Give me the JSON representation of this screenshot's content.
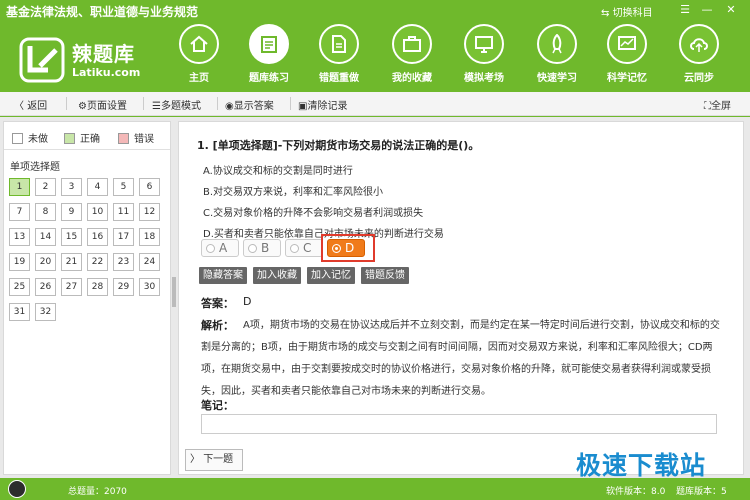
{
  "window": {
    "title": "基金法律法规、职业道德与业务规范",
    "switch_subject": "切换科目"
  },
  "logo": {
    "name": "辣题库",
    "sub": "Latiku.com"
  },
  "nav": [
    {
      "label": "主页",
      "icon": "home-icon"
    },
    {
      "label": "题库练习",
      "icon": "notepad-icon"
    },
    {
      "label": "错题重做",
      "icon": "document-icon"
    },
    {
      "label": "我的收藏",
      "icon": "briefcase-icon"
    },
    {
      "label": "模拟考场",
      "icon": "monitor-icon"
    },
    {
      "label": "快速学习",
      "icon": "rocket-icon"
    },
    {
      "label": "科学记忆",
      "icon": "chart-icon"
    },
    {
      "label": "云同步",
      "icon": "cloud-upload-icon"
    }
  ],
  "toolbar": {
    "back": "返回",
    "page_settings": "页面设置",
    "multi_mode": "多题模式",
    "show_answer": "显示答案",
    "clear_records": "清除记录",
    "fullscreen": "全屏"
  },
  "legend": {
    "undone": "未做",
    "correct": "正确",
    "wrong": "错误",
    "undone_color": "#ffffff",
    "correct_color": "#c8e6a8",
    "wrong_color": "#f4b8b8"
  },
  "section_title": "单项选择题",
  "questions": [
    "1",
    "2",
    "3",
    "4",
    "5",
    "6",
    "7",
    "8",
    "9",
    "10",
    "11",
    "12",
    "13",
    "14",
    "15",
    "16",
    "17",
    "18",
    "19",
    "20",
    "21",
    "22",
    "23",
    "24",
    "25",
    "26",
    "27",
    "28",
    "29",
    "30",
    "31",
    "32"
  ],
  "current_question": "1",
  "question": {
    "title": "1. [单项选择题]-下列对期货市场交易的说法正确的是()。",
    "options": [
      "A.协议成交和标的交割是同时进行",
      "B.对交易双方来说，利率和汇率风险很小",
      "C.交易对象价格的升降不会影响交易者利润或损失",
      "D.买者和卖者只能依靠自己对市场未来的判断进行交易"
    ],
    "choices": [
      "A",
      "B",
      "C",
      "D"
    ],
    "selected": "D"
  },
  "actions": {
    "hide_answer": "隐藏答案",
    "add_favorite": "加入收藏",
    "add_memory": "加入记忆",
    "report_error": "错题反馈"
  },
  "answer": {
    "label": "答案：",
    "value": "D"
  },
  "explanation": {
    "label": "解析：",
    "text": "A项，期货市场的交易在协议达成后并不立刻交割，而是约定在某一特定时间后进行交割，协议成交和标的交割是分离的；B项，由于期货市场的成交与交割之间有时间间隔，因而对交易双方来说，利率和汇率风险很大；CD两项，在期货交易中，由于交割要按成交时的协议价格进行，交易对象价格的升降，就可能使交易者获得利润或蒙受损失，因此，买者和卖者只能依靠自己对市场未来的判断进行交易。"
  },
  "notes": {
    "label": "笔记："
  },
  "next": {
    "label": "下一题"
  },
  "status": {
    "total": "总题量：2070",
    "software_version": "软件版本：8.0",
    "question_version": "题库版本：5"
  },
  "watermark": "极速下载站",
  "colors": {
    "brand_green": "#6fb92c",
    "selected_orange": "#f07b1a",
    "highlight_red": "#e03b2c"
  }
}
